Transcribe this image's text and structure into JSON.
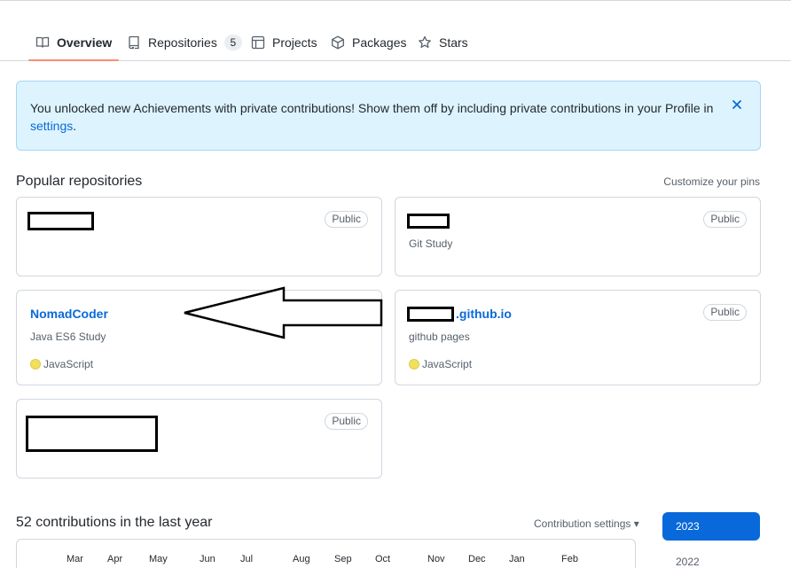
{
  "tabs": [
    {
      "label": "Overview",
      "icon": "book-icon",
      "active": true
    },
    {
      "label": "Repositories",
      "icon": "repo-icon",
      "count": "5"
    },
    {
      "label": "Projects",
      "icon": "table-icon"
    },
    {
      "label": "Packages",
      "icon": "package-icon"
    },
    {
      "label": "Stars",
      "icon": "star-icon"
    }
  ],
  "banner": {
    "text": "You unlocked new Achievements with private contributions! Show them off by including private contributions in your Profile in ",
    "link": "settings",
    "end": "."
  },
  "popular": {
    "title": "Popular repositories",
    "customize": "Customize your pins",
    "repos": [
      {
        "name": "",
        "description": "",
        "visibility": "Public"
      },
      {
        "name": "",
        "description": "Git Study",
        "visibility": "Public"
      },
      {
        "name": "NomadCoder",
        "description": "Java ES6 Study",
        "language": "JavaScript",
        "visibility": "Public"
      },
      {
        "name": ".github.io",
        "description": "github pages",
        "language": "JavaScript",
        "visibility": "Public"
      },
      {
        "name": "",
        "description": "",
        "visibility": "Public"
      }
    ]
  },
  "contributions": {
    "title": "52 contributions in the last year",
    "settings": "Contribution settings ▾",
    "months": [
      "Mar",
      "Apr",
      "May",
      "Jun",
      "Jul",
      "Aug",
      "Sep",
      "Oct",
      "Nov",
      "Dec",
      "Jan",
      "Feb"
    ],
    "years": [
      "2023",
      "2022"
    ],
    "selected_year": "2023"
  },
  "colors": {
    "accent": "#0969da",
    "tab_underline": "#fd8c73",
    "banner_bg": "#ddf4ff",
    "javascript": "#f1e05a"
  }
}
